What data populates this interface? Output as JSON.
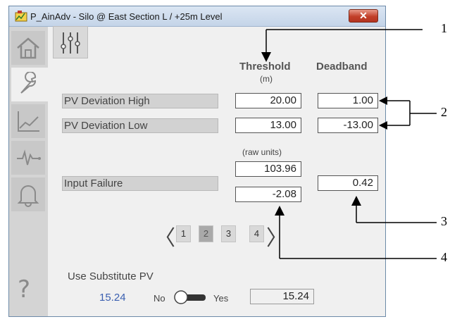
{
  "window": {
    "title": "P_AinAdv - Silo @ East Section L / +25m Level",
    "close_glyph": "✕"
  },
  "sidebar": {
    "tabs": [
      {
        "icon": "home-icon"
      },
      {
        "icon": "wrench-icon"
      },
      {
        "icon": "trend-icon"
      },
      {
        "icon": "pulse-icon"
      },
      {
        "icon": "bell-icon"
      }
    ],
    "help_glyph": "?"
  },
  "headers": {
    "threshold": "Threshold",
    "threshold_unit": "(m)",
    "deadband": "Deadband",
    "raw_units": "(raw units)"
  },
  "rows": {
    "pv_dev_high": {
      "label": "PV Deviation High",
      "threshold": "20.00",
      "deadband": "1.00"
    },
    "pv_dev_low": {
      "label": "PV Deviation Low",
      "threshold": "13.00",
      "deadband": "-13.00"
    },
    "input_failure": {
      "label": "Input Failure",
      "threshold_high": "103.96",
      "threshold_low": "-2.08",
      "deadband": "0.42"
    }
  },
  "pager": {
    "prev": "〈",
    "next": "〉",
    "pages": [
      "1",
      "2",
      "3",
      "4"
    ],
    "current": "2"
  },
  "substitute": {
    "label": "Use Substitute PV",
    "pv_value": "15.24",
    "no_label": "No",
    "yes_label": "Yes",
    "toggle_state": "No",
    "input_value": "15.24"
  },
  "callouts": [
    "1",
    "2",
    "3",
    "4"
  ],
  "colors": {
    "pv_value": "#3a5fb0",
    "active_page": "#a9a9a9"
  }
}
